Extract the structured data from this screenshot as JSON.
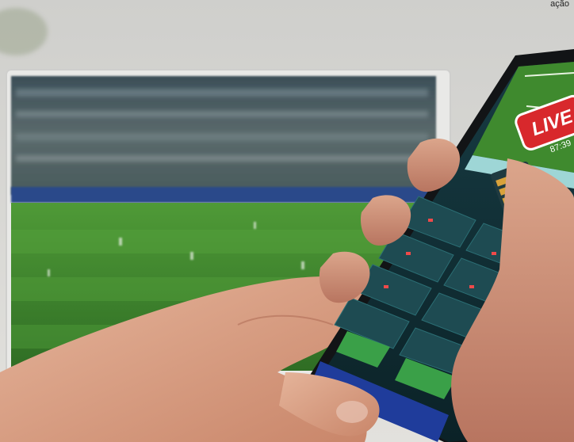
{
  "caption_fragment": "ação",
  "phone_screen": {
    "live_badge": "LIVE",
    "match_time": "87:39"
  },
  "colors": {
    "pitch_green": "#3f8a2e",
    "stands_blue": "#2a4a8a",
    "live_red": "#d8282c",
    "screen_dark": "#0f2b33",
    "cta_blue": "#1f3c9b"
  }
}
